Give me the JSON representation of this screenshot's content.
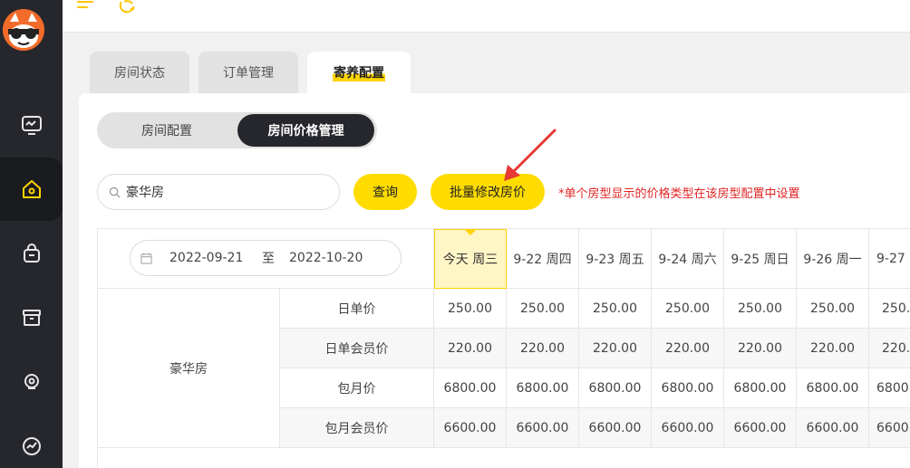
{
  "tabs": [
    "房间状态",
    "订单管理",
    "寄养配置"
  ],
  "segment": {
    "left": "房间配置",
    "right": "房间价格管理"
  },
  "search": {
    "value": "豪华房"
  },
  "buttons": {
    "query": "查询",
    "batch": "批量修改房价"
  },
  "note": "*单个房型显示的价格类型在该房型配置中设置",
  "date_range": {
    "start": "2022-09-21",
    "sep": "至",
    "end": "2022-10-20"
  },
  "days": [
    "今天 周三",
    "9-22 周四",
    "9-23 周五",
    "9-24 周六",
    "9-25 周日",
    "9-26 周一",
    "9-27"
  ],
  "room_name": "豪华房",
  "price_rows": [
    {
      "label": "日单价",
      "values": [
        "250.00",
        "250.00",
        "250.00",
        "250.00",
        "250.00",
        "250.00",
        "250."
      ]
    },
    {
      "label": "日单会员价",
      "values": [
        "220.00",
        "220.00",
        "220.00",
        "220.00",
        "220.00",
        "220.00",
        "220."
      ]
    },
    {
      "label": "包月价",
      "values": [
        "6800.00",
        "6800.00",
        "6800.00",
        "6800.00",
        "6800.00",
        "6800.00",
        "6800"
      ]
    },
    {
      "label": "包月会员价",
      "values": [
        "6600.00",
        "6600.00",
        "6600.00",
        "6600.00",
        "6600.00",
        "6600.00",
        "6600"
      ]
    }
  ],
  "colors": {
    "accent": "#ffdc00",
    "dark": "#26272c",
    "warning": "#e02424",
    "today_bg": "#fff6c6"
  }
}
